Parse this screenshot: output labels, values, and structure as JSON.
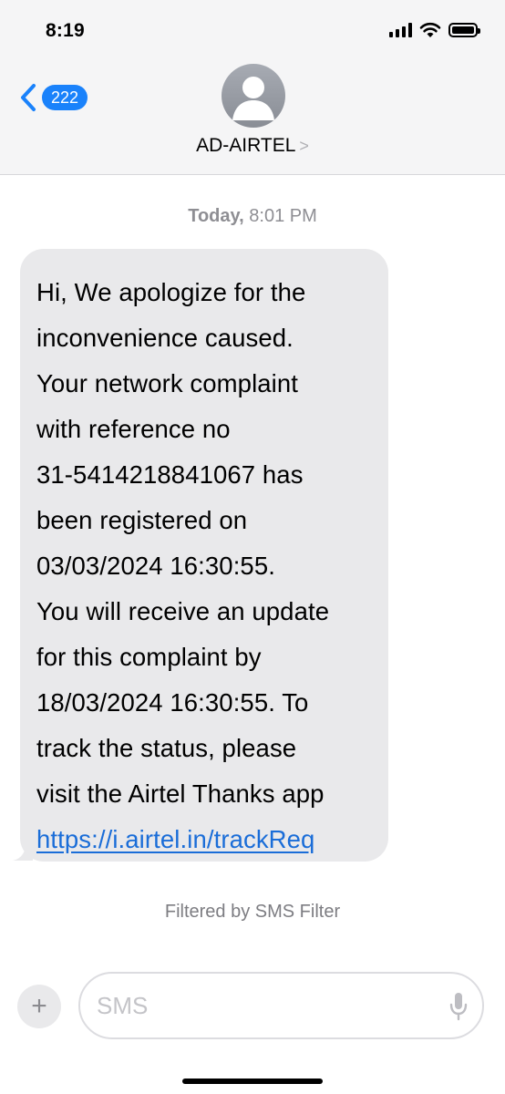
{
  "status_bar": {
    "time": "8:19"
  },
  "nav": {
    "back_badge": "222",
    "contact_name": "AD-AIRTEL",
    "contact_chevron": ">"
  },
  "thread": {
    "timestamp_day": "Today,",
    "timestamp_time": "8:01 PM",
    "message_lines": [
      "Hi, We apologize for the",
      "inconvenience caused.",
      "Your network complaint",
      "with reference no",
      "31-5414218841067 has",
      "been registered on",
      "03/03/2024 16:30:55.",
      "You will receive an update",
      "for this complaint by",
      "18/03/2024 16:30:55. To",
      "track the status, please",
      "visit the Airtel Thanks app"
    ],
    "message_link": "https://i.airtel.in/trackReq",
    "filter_note": "Filtered by SMS Filter"
  },
  "composer": {
    "plus": "+",
    "placeholder": "SMS"
  },
  "icons": {
    "back": "chevron-left-icon",
    "avatar": "person-silhouette-icon",
    "signal": "cellular-signal-icon",
    "wifi": "wifi-icon",
    "battery": "battery-icon",
    "mic": "microphone-icon"
  },
  "colors": {
    "accent": "#1a82fb",
    "bubble": "#e9e9eb",
    "link": "#1a6dd8",
    "header_bg": "#f5f5f6"
  }
}
